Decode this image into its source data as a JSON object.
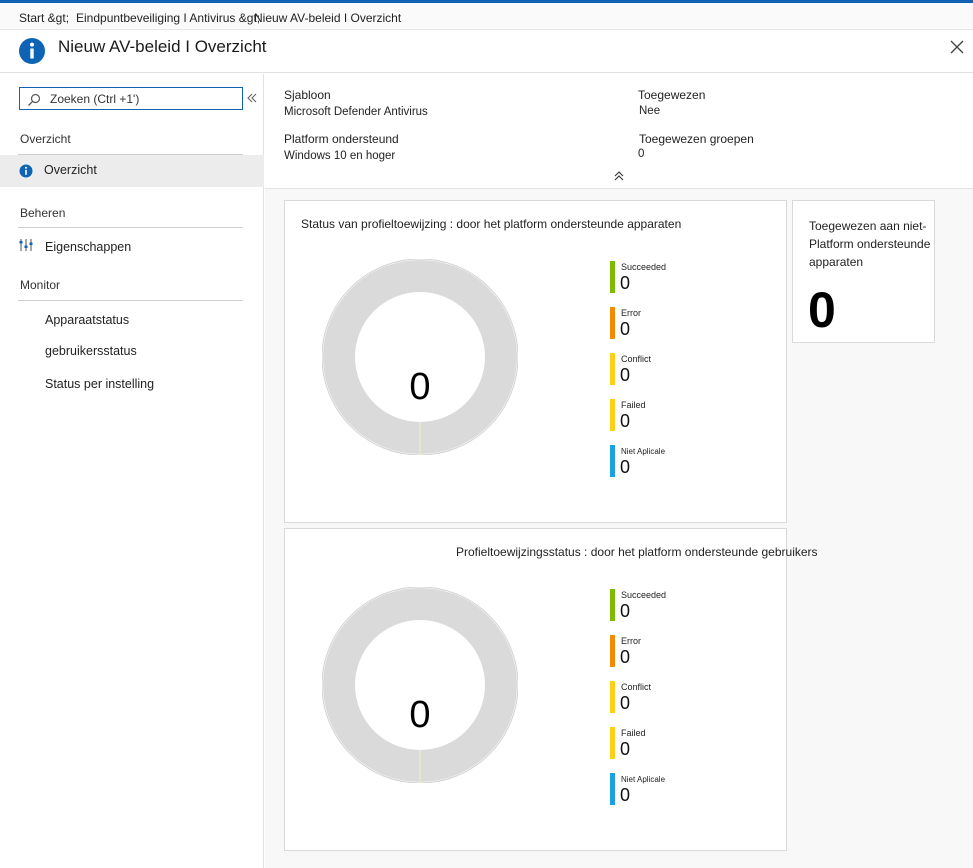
{
  "breadcrumb": {
    "items": [
      "Start &gt;",
      "Eindpuntbeveiliging I Antivirus &gt;",
      "Nieuw AV-beleid I Overzicht"
    ]
  },
  "header": {
    "title": "Nieuw AV-beleid I Overzicht",
    "icon": "info-icon",
    "accent_color": "#0e63b4"
  },
  "sidebar": {
    "search_placeholder": "Zoeken (Ctrl +1')",
    "sections": {
      "overview": "Overzicht",
      "manage": "Beheren",
      "monitor": "Monitor"
    },
    "items": {
      "overview": "Overzicht",
      "properties": "Eigenschappen",
      "device_status": "Apparaatstatus",
      "user_status": "gebruikersstatus",
      "per_setting": "Status per instelling"
    }
  },
  "essentials": {
    "template_label": "Sjabloon",
    "template_value": "Microsoft Defender Antivirus",
    "platform_label": "Platform ondersteund",
    "platform_value": "Windows 10 en hoger",
    "assigned_label": "Toegewezen",
    "assigned_value": "Nee",
    "groups_label": "Toegewezen groepen",
    "groups_value": "0"
  },
  "cards": {
    "devices": {
      "title": "Status van profieltoewijzing : door het platform ondersteunde apparaten",
      "center": "0",
      "legend": [
        {
          "name": "Succeeded",
          "value": "0",
          "color": "#7fba00"
        },
        {
          "name": "Error",
          "value": "0",
          "color": "#f08c00"
        },
        {
          "name": "Conflict",
          "value": "0",
          "color": "#fcd116"
        },
        {
          "name": "Failed",
          "value": "0",
          "color": "#fcd116"
        },
        {
          "name": "Niet Aplicale",
          "value": "0",
          "color": "#1ba1e2"
        }
      ]
    },
    "users": {
      "title": "Profieltoewijzingsstatus : door het platform ondersteunde gebruikers",
      "center": "0",
      "legend": [
        {
          "name": "Succeeded",
          "value": "0",
          "color": "#7fba00"
        },
        {
          "name": "Error",
          "value": "0",
          "color": "#f08c00"
        },
        {
          "name": "Conflict",
          "value": "0",
          "color": "#fcd116"
        },
        {
          "name": "Failed",
          "value": "0",
          "color": "#fcd116"
        },
        {
          "name": "Niet Aplicale",
          "value": "0",
          "color": "#1ba1e2"
        }
      ]
    },
    "unsupported": {
      "text": "Toegewezen aan niet-Platform ondersteunde apparaten",
      "value": "0"
    }
  }
}
